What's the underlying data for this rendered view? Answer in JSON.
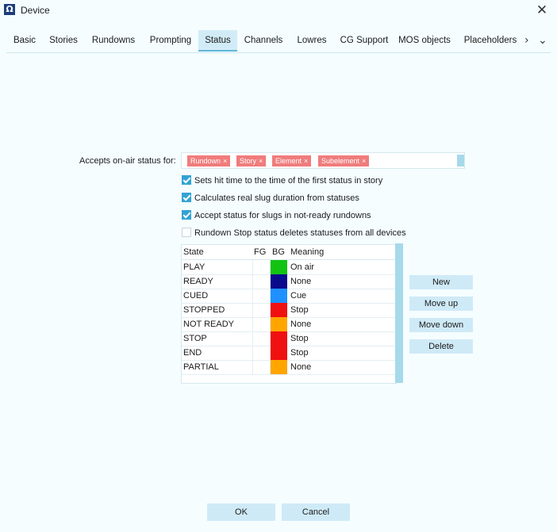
{
  "window": {
    "title": "Device",
    "app_icon": "Ω",
    "close_icon": "✕"
  },
  "tabs": [
    {
      "label": "Basic"
    },
    {
      "label": "Stories"
    },
    {
      "label": "Rundowns"
    },
    {
      "label": "Prompting"
    },
    {
      "label": "Status",
      "active": true
    },
    {
      "label": "Channels"
    },
    {
      "label": "Lowres"
    },
    {
      "label": "CG Support"
    },
    {
      "label": "MOS objects"
    },
    {
      "label": "Placeholders"
    }
  ],
  "tab_nav": {
    "next_icon": "›",
    "more_icon": "⌄"
  },
  "accepts": {
    "label": "Accepts on-air status for:",
    "tags": [
      {
        "label": "Rundown"
      },
      {
        "label": "Story"
      },
      {
        "label": "Element"
      },
      {
        "label": "Subelement"
      }
    ],
    "remove_icon": "×",
    "tag_color": "#f07c7c"
  },
  "options": [
    {
      "label": "Sets hit time to the time of the first status in story",
      "checked": true
    },
    {
      "label": "Calculates real slug duration from statuses",
      "checked": true
    },
    {
      "label": "Accept status for slugs in not-ready rundowns",
      "checked": true
    },
    {
      "label": "Rundown Stop status deletes statuses from all devices",
      "checked": false
    }
  ],
  "table": {
    "columns": {
      "state": "State",
      "fg": "FG",
      "bg": "BG",
      "meaning": "Meaning"
    },
    "rows": [
      {
        "state": "PLAY",
        "bg": "#12c312",
        "meaning": "On air"
      },
      {
        "state": "READY",
        "bg": "#0a0a8c",
        "meaning": "None"
      },
      {
        "state": "CUED",
        "bg": "#1e90ff",
        "meaning": "Cue"
      },
      {
        "state": "STOPPED",
        "bg": "#f01010",
        "meaning": "Stop"
      },
      {
        "state": "NOT READY",
        "bg": "#ffa500",
        "meaning": "None"
      },
      {
        "state": "STOP",
        "bg": "#f01010",
        "meaning": "Stop"
      },
      {
        "state": "END",
        "bg": "#f01010",
        "meaning": "Stop"
      },
      {
        "state": "PARTIAL",
        "bg": "#ffa500",
        "meaning": "None"
      }
    ]
  },
  "side_buttons": {
    "new": "New",
    "move_up": "Move up",
    "move_down": "Move down",
    "delete": "Delete"
  },
  "bottom_buttons": {
    "ok": "OK",
    "cancel": "Cancel"
  },
  "colors": {
    "accent": "#33a3d4",
    "button_bg": "#cfeaf7",
    "background": "#f5fdff"
  }
}
